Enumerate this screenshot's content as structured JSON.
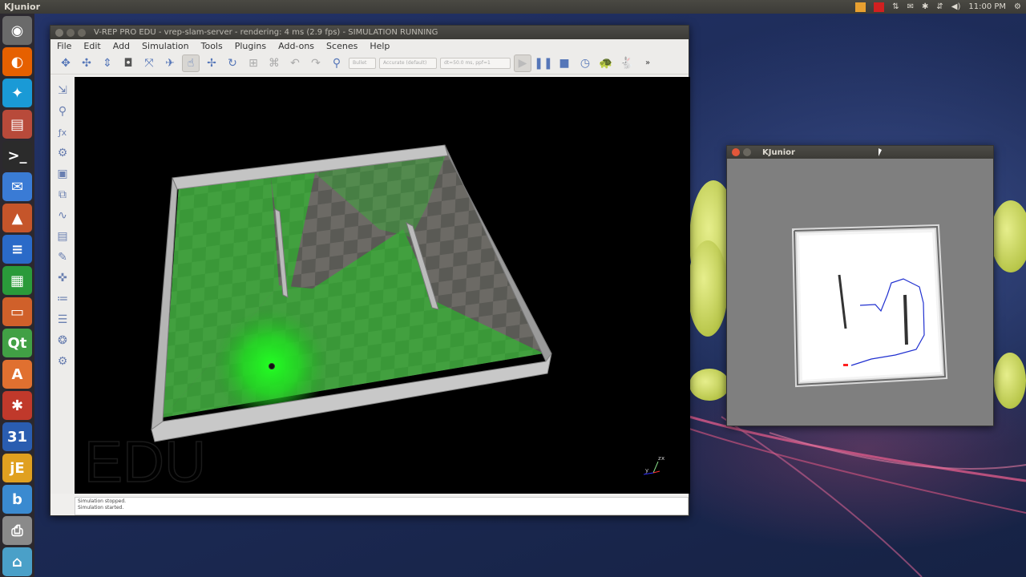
{
  "top_panel": {
    "app_title": "KJunior",
    "clock": "11:00 PM"
  },
  "launcher": {
    "items": [
      {
        "name": "ubuntu-dash",
        "glyph": "◉",
        "color": "#6a6a6a"
      },
      {
        "name": "firefox",
        "glyph": "◐",
        "color": "#e66000"
      },
      {
        "name": "app-runner",
        "glyph": "✦",
        "color": "#1a9ad6"
      },
      {
        "name": "files",
        "glyph": "▤",
        "color": "#b84a3a"
      },
      {
        "name": "terminal",
        "glyph": ">_",
        "color": "#2b2b2b"
      },
      {
        "name": "thunderbird",
        "glyph": "✉",
        "color": "#3a7bd5"
      },
      {
        "name": "matlab",
        "glyph": "▲",
        "color": "#c5552a"
      },
      {
        "name": "writer",
        "glyph": "≡",
        "color": "#2a6ac8"
      },
      {
        "name": "calc",
        "glyph": "▦",
        "color": "#2a9a3a"
      },
      {
        "name": "impress",
        "glyph": "▭",
        "color": "#d0602a"
      },
      {
        "name": "qt-creator",
        "glyph": "Qt",
        "color": "#41a045"
      },
      {
        "name": "software-center",
        "glyph": "A",
        "color": "#e07030"
      },
      {
        "name": "system-settings",
        "glyph": "✱",
        "color": "#c0392b"
      },
      {
        "name": "calendar",
        "glyph": "31",
        "color": "#2a5db0"
      },
      {
        "name": "java-ide",
        "glyph": "jE",
        "color": "#e0a020"
      },
      {
        "name": "bleachbit",
        "glyph": "b",
        "color": "#3a8ad0"
      },
      {
        "name": "printer",
        "glyph": "⎙",
        "color": "#8a8a8a"
      },
      {
        "name": "scanner",
        "glyph": "⌂",
        "color": "#4aa0c8"
      }
    ]
  },
  "vrep": {
    "title": "V-REP PRO EDU - vrep-slam-server - rendering: 4 ms (2.9 fps) - SIMULATION RUNNING",
    "menu": [
      "File",
      "Edit",
      "Add",
      "Simulation",
      "Tools",
      "Plugins",
      "Add-ons",
      "Scenes",
      "Help"
    ],
    "combos": {
      "engine": "Bullet",
      "accuracy": "Accurate (default)",
      "timestep": "dt=50.0 ms, ppf=1"
    },
    "watermark": "EDU",
    "axis_labels": {
      "z": "z",
      "x": "x",
      "y": "y"
    },
    "status_lines": [
      "Simulation stopped.",
      "Simulation started."
    ]
  },
  "kjunior": {
    "title": "KJunior"
  },
  "colors": {
    "laser": "#22ff22",
    "path": "#2030d0",
    "robot_marker": "#ff2020"
  }
}
